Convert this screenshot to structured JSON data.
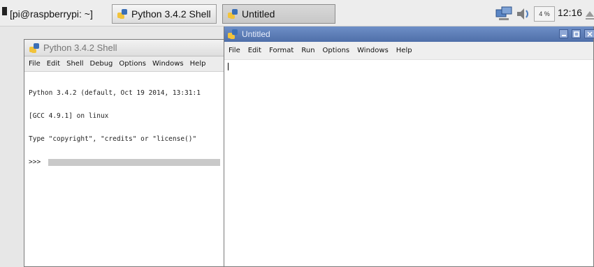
{
  "taskbar": {
    "terminal_label": "[pi@raspberrypi: ~]",
    "shell_task_label": "Python 3.4.2 Shell",
    "untitled_task_label": "Untitled",
    "cpu_label": "4 %",
    "clock": "12:16"
  },
  "shell_window": {
    "title": "Python 3.4.2 Shell",
    "menu": [
      "File",
      "Edit",
      "Shell",
      "Debug",
      "Options",
      "Windows",
      "Help"
    ],
    "lines": [
      "Python 3.4.2 (default, Oct 19 2014, 13:31:1",
      "[GCC 4.9.1] on linux",
      "Type \"copyright\", \"credits\" or \"license()\""
    ],
    "prompt": ">>>"
  },
  "editor_window": {
    "title": "Untitled",
    "menu": [
      "File",
      "Edit",
      "Format",
      "Run",
      "Options",
      "Windows",
      "Help"
    ]
  },
  "colors": {
    "editor_titlebar": "#5877b2",
    "desktop": "#e7e7e7"
  }
}
